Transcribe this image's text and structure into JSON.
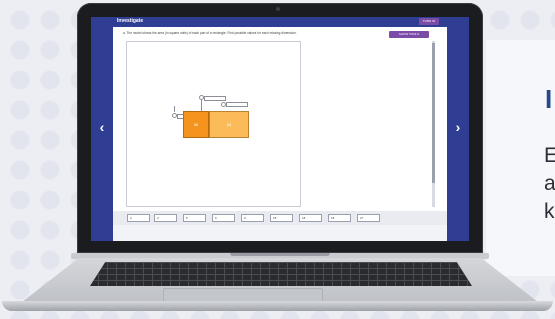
{
  "promo": {
    "title": "I",
    "lines": "E\na\nk"
  },
  "app": {
    "title": "Investigate",
    "header_button": "TURN IN",
    "prompt": "a. The model shows the area (in square units) of each part of a rectangle. Find possible values for each missing dimension.",
    "action_button": "SHOW TOOLS",
    "rect_values": [
      "36",
      "54"
    ],
    "answer_chips": [
      "2",
      "3",
      "5",
      "6",
      "9",
      "18",
      "18",
      "18",
      "27"
    ]
  },
  "colors": {
    "screen_blue": "#2f3d93",
    "accent_purple": "#7b4ba8",
    "rect_dark": "#f4941f",
    "rect_light": "#fbbb59",
    "promo_title": "#27488d"
  },
  "icons": {
    "nav_left": "chevron-left-icon",
    "nav_right": "chevron-right-icon"
  }
}
